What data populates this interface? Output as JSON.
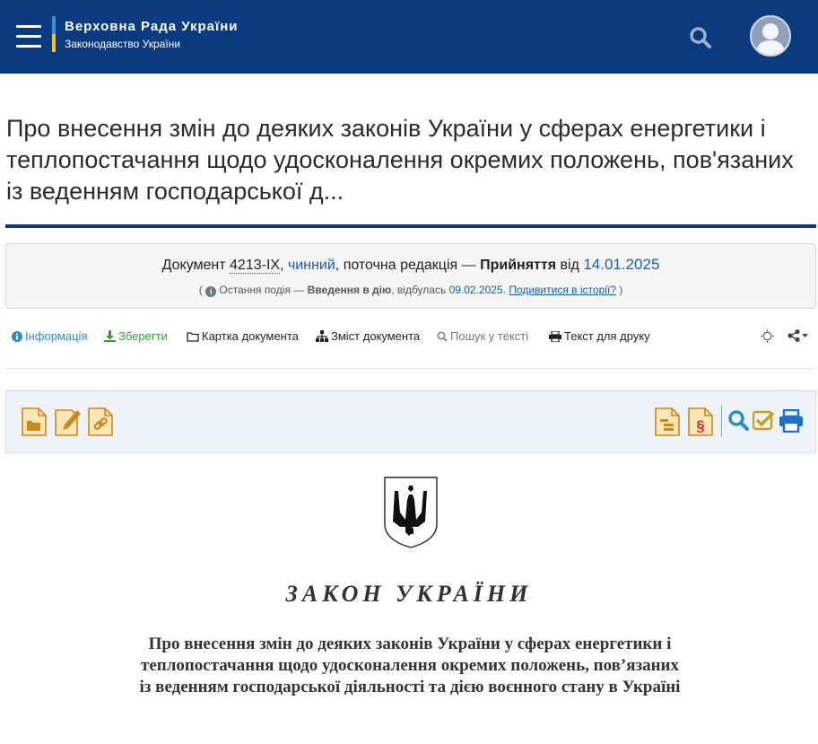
{
  "header": {
    "site_title": "Верховна Рада України",
    "site_subtitle": "Законодавство України",
    "menu_icon": "hamburger-menu-icon",
    "search_icon": "search-icon",
    "user_icon": "user-avatar-icon",
    "colors": {
      "bar": "#0b3a7e",
      "flag_blue": "#3c8dde",
      "flag_yellow": "#f5c518"
    }
  },
  "document": {
    "title": "Про внесення змін до деяких законів України у сферах енергетики і теплопостачання щодо удосконалення окремих положень, пов'язаних із веденням господарської д..."
  },
  "status": {
    "prefix": "Документ",
    "number": "4213-IX",
    "comma1": ",",
    "state": "чинний",
    "mid": ", поточна редакція —",
    "edition": "Прийняття",
    "from": "від",
    "date": "14.01.2025",
    "event_open": "(",
    "event_prefix": "Остання подія —",
    "event_name": "Введення в дію",
    "event_mid": ", відбулась",
    "event_date": "09.02.2025",
    "event_dot": ".",
    "history_link": "Подивитися в історії?",
    "event_close": ")"
  },
  "tabs": {
    "info": "Інформація",
    "save": "Зберегти",
    "card": "Картка документа",
    "toc": "Зміст документа",
    "find": "Пошук у тексті",
    "print": "Текст для друку"
  },
  "toolbar_icons": [
    "folder-doc-icon",
    "edit-doc-icon",
    "link-doc-icon",
    "structure-doc-icon",
    "paragraph-doc-icon",
    "search-icon",
    "check-icon",
    "print-icon"
  ],
  "body": {
    "emblem": "ukraine-coat-of-arms-icon",
    "heading": "ЗАКОН УКРАЇНИ",
    "law_title": "Про внесення змін до деяких законів України у сферах енергетики і теплопостачання щодо удосконалення окремих положень, пов’язаних із веденням господарської діяльності та дією воєнного стану в Україні"
  }
}
